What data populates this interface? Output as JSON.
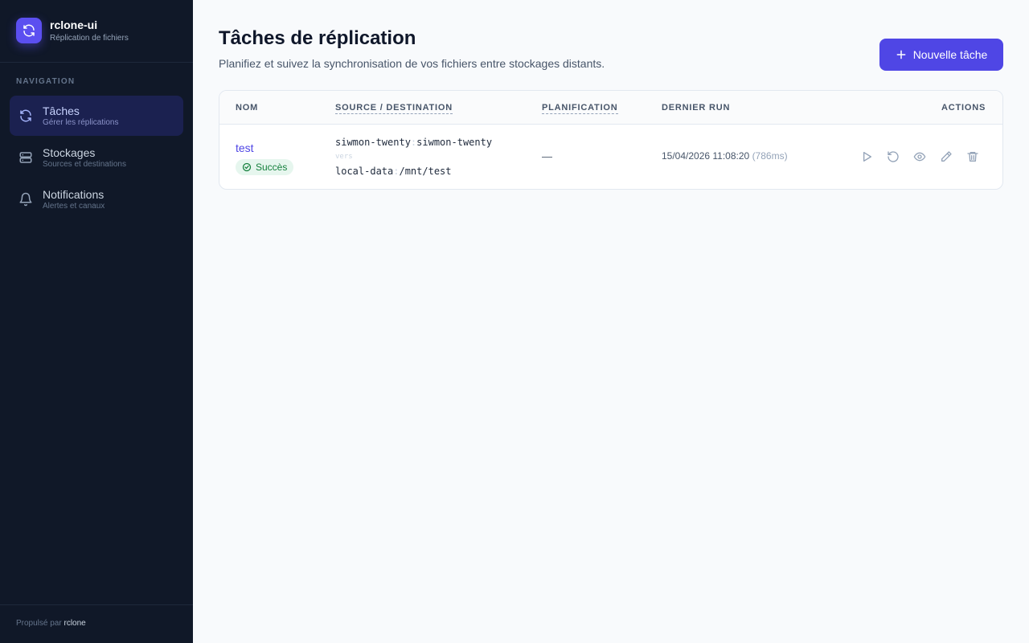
{
  "app": {
    "name": "rclone-ui",
    "subtitle": "Réplication de fichiers"
  },
  "sidebar": {
    "heading": "NAVIGATION",
    "items": [
      {
        "label": "Tâches",
        "desc": "Gérer les réplications",
        "icon": "refresh-icon",
        "active": true
      },
      {
        "label": "Stockages",
        "desc": "Sources et destinations",
        "icon": "server-icon",
        "active": false
      },
      {
        "label": "Notifications",
        "desc": "Alertes et canaux",
        "icon": "bell-icon",
        "active": false
      }
    ],
    "footer_prefix": "Propulsé par",
    "footer_brand": "rclone"
  },
  "page": {
    "title": "Tâches de réplication",
    "subtitle": "Planifiez et suivez la synchronisation de vos fichiers entre stockages distants.",
    "new_button": "Nouvelle tâche",
    "new_button_icon": "plus-icon"
  },
  "table": {
    "columns": [
      "NOM",
      "SOURCE / DESTINATION",
      "PLANIFICATION",
      "DERNIER RUN",
      "ACTIONS"
    ],
    "rows": [
      {
        "name": "test",
        "status": "Succès",
        "source_remote": "siwmon-twenty",
        "source_path": "siwmon-twenty",
        "connector": "vers",
        "dest_remote": "local-data",
        "dest_path": "/mnt/test",
        "schedule": "—",
        "last_run": "15/04/2026 11:08:20",
        "duration": "(786ms)",
        "actions": [
          "play-icon",
          "rotate-icon",
          "eye-icon",
          "pencil-icon",
          "trash-icon"
        ]
      }
    ]
  },
  "colors": {
    "accent": "#4f46e5",
    "sidebar_bg": "#101828",
    "success_bg": "#e6f6ee",
    "success_text": "#15803d"
  }
}
